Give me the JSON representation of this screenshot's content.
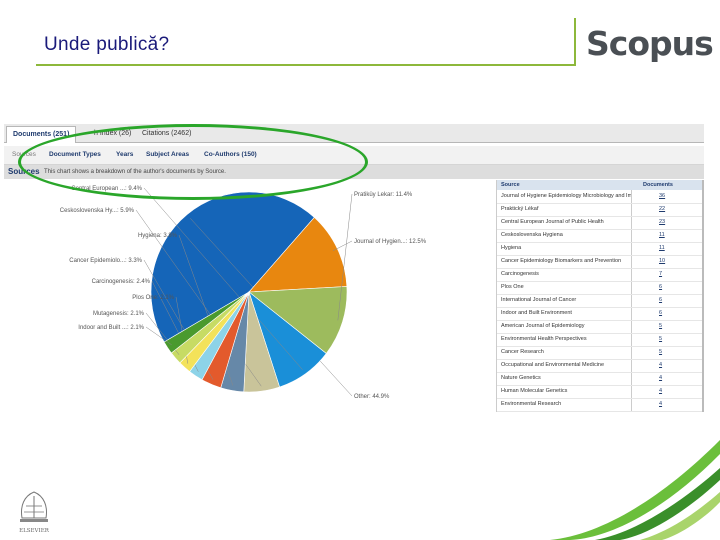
{
  "slide": {
    "title": "Unde publică?",
    "logo": "Scopus",
    "publisher_logo": "ELSEVIER"
  },
  "tabs": [
    {
      "label": "Documents (251)",
      "active": true
    },
    {
      "label": "h Index (26)",
      "active": false
    },
    {
      "label": "Citations (2462)",
      "active": false
    }
  ],
  "subnav": {
    "label": "Sources",
    "links": [
      "Document Types",
      "Years",
      "Subject Areas",
      "Co-Authors (150)"
    ]
  },
  "sources_bar": {
    "heading": "Sources",
    "description": "This chart shows a breakdown of the author's documents by Source."
  },
  "chart_data": {
    "type": "pie",
    "slices": [
      {
        "label": "Other: 44.9%",
        "value": 44.9,
        "color": "#1565b8"
      },
      {
        "label": "Journal of Hygien...: 12.5%",
        "value": 12.5,
        "color": "#e8870f"
      },
      {
        "label": "Pratiküy Lekar: 11.4%",
        "value": 11.4,
        "color": "#9dbb5d"
      },
      {
        "label": "Central European ...: 9.4%",
        "value": 9.4,
        "color": "#1a8fd8"
      },
      {
        "label": "Ceskoslovenska Hy...: 5.9%",
        "value": 5.9,
        "color": "#c9c49a"
      },
      {
        "label": "Hygiena: 3.8%",
        "value": 3.8,
        "color": "#6688a8"
      },
      {
        "label": "Cancer Epidemiolo...: 3.3%",
        "value": 3.3,
        "color": "#e35a2c"
      },
      {
        "label": "Carcinogenesis: 2.4%",
        "value": 2.4,
        "color": "#8dd3e8"
      },
      {
        "label": "Plos One: 2.1%",
        "value": 2.1,
        "color": "#f3e25a"
      },
      {
        "label": "Mutagenesis: 2.1%",
        "value": 2.1,
        "color": "#c7db64"
      },
      {
        "label": "Indoor and Built ...: 2.1%",
        "value": 2.1,
        "color": "#4a9a2e"
      }
    ]
  },
  "table": {
    "headers": [
      "Source",
      "Documents"
    ],
    "rows": [
      {
        "source": "Journal of Hygiene Epidemiology Microbiology and Immunology",
        "documents": "36"
      },
      {
        "source": "Praktický Lékař",
        "documents": "22"
      },
      {
        "source": "Central European Journal of Public Health",
        "documents": "23"
      },
      {
        "source": "Ceskoslovenska Hygiena",
        "documents": "11"
      },
      {
        "source": "Hygiena",
        "documents": "11"
      },
      {
        "source": "Cancer Epidemiology Biomarkers and Prevention",
        "documents": "10"
      },
      {
        "source": "Carcinogenesis",
        "documents": "7"
      },
      {
        "source": "Plos One",
        "documents": "6"
      },
      {
        "source": "International Journal of Cancer",
        "documents": "6"
      },
      {
        "source": "Indoor and Built Environment",
        "documents": "6"
      },
      {
        "source": "American Journal of Epidemiology",
        "documents": "5"
      },
      {
        "source": "Environmental Health Perspectives",
        "documents": "5"
      },
      {
        "source": "Cancer Research",
        "documents": "5"
      },
      {
        "source": "Occupational and Environmental Medicine",
        "documents": "4"
      },
      {
        "source": "Nature Genetics",
        "documents": "4"
      },
      {
        "source": "Human Molecular Genetics",
        "documents": "4"
      },
      {
        "source": "Environmental Research",
        "documents": "4"
      }
    ]
  },
  "colors": {
    "title": "#1a1a7a",
    "accent": "#8db83b",
    "highlight": "#2aa62a"
  }
}
